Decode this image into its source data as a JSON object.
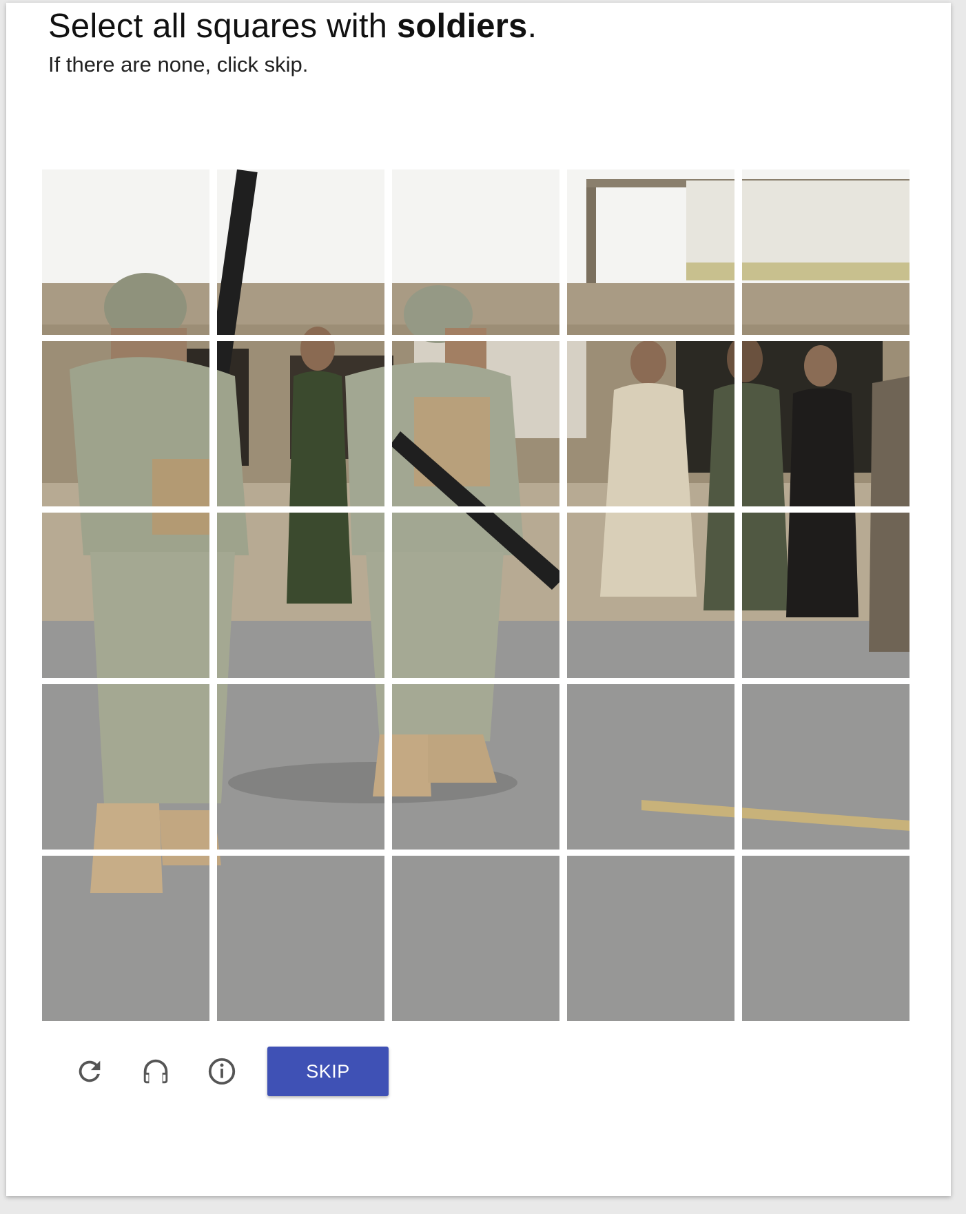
{
  "challenge": {
    "prompt_prefix": "Select all squares with ",
    "prompt_target": "soldiers",
    "prompt_suffix": ".",
    "subprompt": "If there are none, click skip."
  },
  "grid": {
    "rows": 5,
    "columns": 5
  },
  "controls": {
    "refresh_icon": "refresh-icon",
    "audio_icon": "headphones-icon",
    "info_icon": "info-icon",
    "skip_label": "SKIP"
  },
  "colors": {
    "skip_button": "#3f51b5",
    "card_background": "#ffffff"
  }
}
